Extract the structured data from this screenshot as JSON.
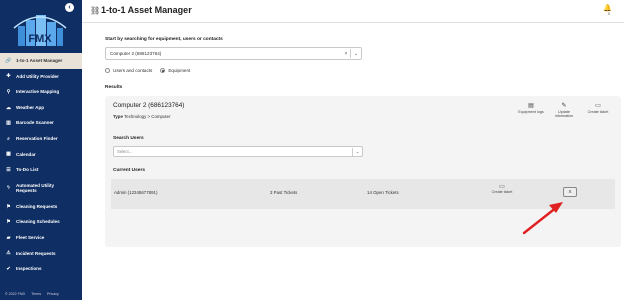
{
  "sidebar": {
    "collapse_icon": "chevron-left-icon",
    "logo_text": "FMX",
    "items": [
      {
        "label": "1-to-1 Asset Manager",
        "icon": "link-icon",
        "active": true
      },
      {
        "label": "Add Utility Provider",
        "icon": "plus-icon"
      },
      {
        "label": "Interactive Mapping",
        "icon": "map-pin-icon"
      },
      {
        "label": "Weather App",
        "icon": "cloud-icon"
      },
      {
        "label": "Barcode Scanner",
        "icon": "barcode-icon"
      },
      {
        "label": "Reservation Finder",
        "icon": "search-icon"
      },
      {
        "label": "Calendar",
        "icon": "calendar-icon"
      },
      {
        "label": "To-Do List",
        "icon": "list-icon"
      },
      {
        "label": "Automated Utility Requests",
        "icon": "bolt-icon"
      },
      {
        "label": "Cleaning Requests",
        "icon": "flag-icon"
      },
      {
        "label": "Cleaning Schedules",
        "icon": "flag-icon"
      },
      {
        "label": "Fleet Service",
        "icon": "truck-icon"
      },
      {
        "label": "Incident Requests",
        "icon": "alert-icon"
      },
      {
        "label": "Inspections",
        "icon": "check-icon"
      }
    ],
    "footer": {
      "copyright": "© 2022 FMX",
      "terms": "Terms",
      "privacy": "Privacy"
    }
  },
  "header": {
    "title": "1-to-1 Asset Manager",
    "title_icon": "link-icon",
    "bell_icon": "bell-icon",
    "bell_sub": "0"
  },
  "search": {
    "label": "Start by searching for equipment, users or contacts",
    "value": "Computer 2 (686123764)",
    "clear": "×",
    "chevron": "⌄"
  },
  "mode": {
    "options": [
      {
        "label": "Users and contacts",
        "checked": false
      },
      {
        "label": "Equipment",
        "checked": true
      }
    ]
  },
  "results": {
    "label": "Results",
    "asset": {
      "title": "Computer 2 (686123764)",
      "type_label": "Type",
      "type_value": "Technology > Computer"
    },
    "actions": [
      {
        "label": "Equipment logs",
        "icon": "book-icon"
      },
      {
        "label": "Update information",
        "icon": "pencil-icon"
      },
      {
        "label": "Create ticket",
        "icon": "monitor-icon"
      }
    ],
    "search_users": {
      "label": "Search Users",
      "placeholder": "Select...",
      "chevron": "⌄"
    },
    "current_users": {
      "label": "Current Users",
      "rows": [
        {
          "name": "Admin (12345677891)",
          "past": "3 Past Tickets",
          "open": "14 Open Tickets",
          "create_label": "Create ticket",
          "remove_label": "X"
        }
      ]
    }
  },
  "colors": {
    "sidebar_bg": "#0f2e63",
    "active_bg": "#e9e2d9",
    "arrow": "#e02020"
  }
}
